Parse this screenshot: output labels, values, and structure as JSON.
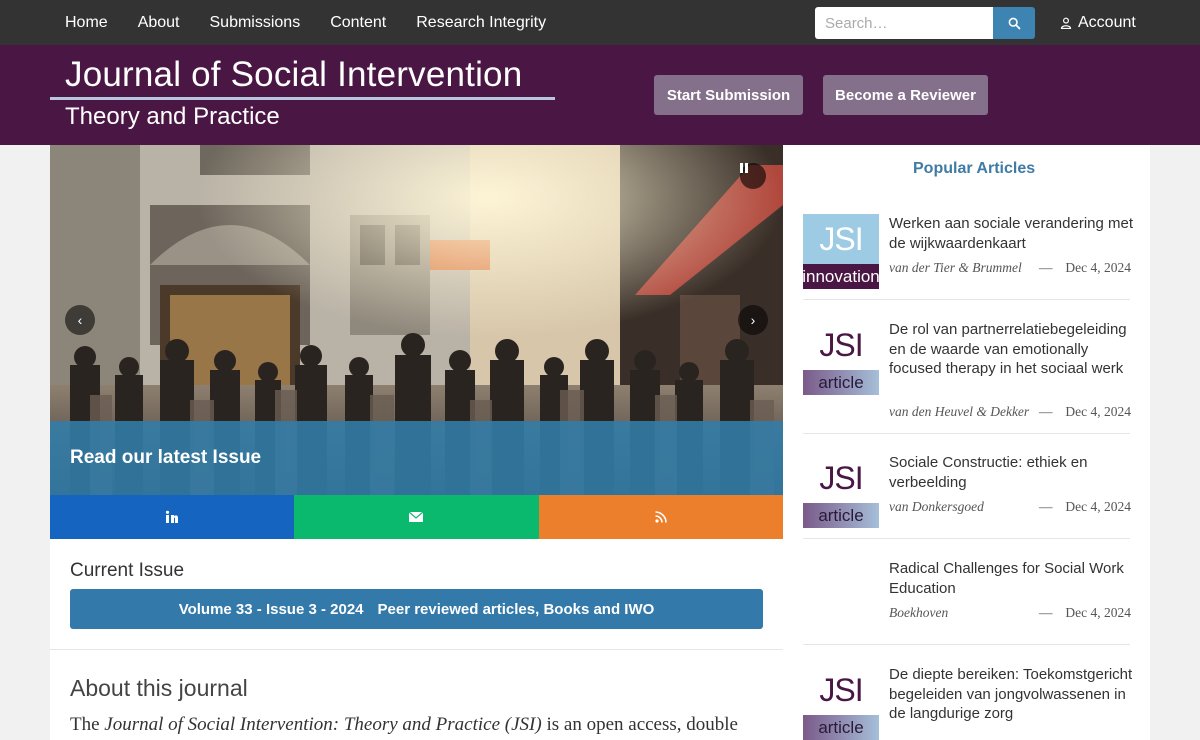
{
  "nav": {
    "items": [
      "Home",
      "About",
      "Submissions",
      "Content",
      "Research Integrity"
    ],
    "search_placeholder": "Search…",
    "account_label": "Account"
  },
  "masthead": {
    "title": "Journal of Social Intervention",
    "subtitle": "Theory and Practice",
    "start_submission": "Start Submission",
    "become_reviewer": "Become a Reviewer"
  },
  "hero": {
    "caption": "Read our latest Issue"
  },
  "current_issue": {
    "heading": "Current Issue",
    "volume": "Volume 33 - Issue 3 - 2024",
    "description": "Peer reviewed articles, Books and IWO"
  },
  "about": {
    "heading": "About this journal",
    "intro_prefix": "The ",
    "intro_title": "Journal of Social Intervention: Theory and Practice (JSI)",
    "intro_suffix": " is an open access, double"
  },
  "sidebar": {
    "heading": "Popular Articles",
    "articles": [
      {
        "badge_top": "JSI",
        "badge_bottom": "innovation",
        "title": "Werken aan sociale verandering met de wijkwaardenkaart",
        "authors": "van der Tier & Brummel",
        "dash": "—",
        "date": "Dec 4, 2024"
      },
      {
        "badge_top": "JSI",
        "badge_bottom": "article",
        "title": "De rol van partnerrelatiebegeleiding en de waarde van emotionally focused therapy in het sociaal werk",
        "authors": "van den Heuvel & Dekker",
        "dash": "—",
        "date": "Dec 4, 2024"
      },
      {
        "badge_top": "JSI",
        "badge_bottom": "article",
        "title": "Sociale Constructie: ethiek en verbeelding",
        "authors": "van Donkersgoed",
        "dash": "—",
        "date": "Dec 4, 2024"
      },
      {
        "title": "Radical Challenges for Social Work Education",
        "authors": "Boekhoven",
        "dash": "—",
        "date": "Dec 4, 2024"
      },
      {
        "badge_top": "JSI",
        "badge_bottom": "article",
        "title": "De diepte bereiken: Toekomstgericht begeleiden van jongvolwassenen in de langdurige zorg"
      }
    ]
  },
  "colors": {
    "topnav": "#333333",
    "masthead": "#4a1744",
    "accent_blue": "#3379aa",
    "linkedin": "#1464c0",
    "email": "#0ab86e",
    "rss": "#ec7f2c"
  }
}
